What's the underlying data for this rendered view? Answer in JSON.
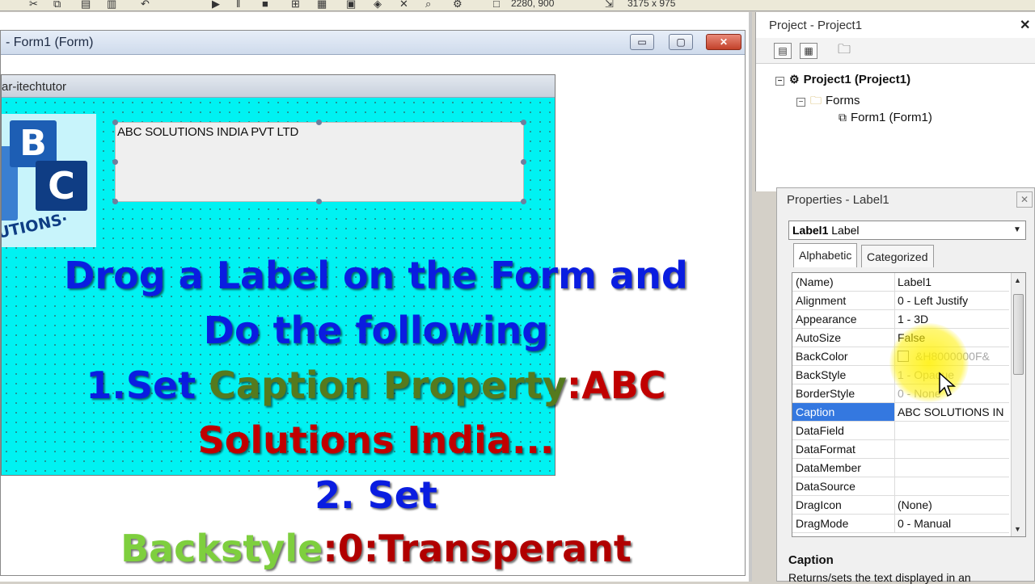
{
  "toolbar": {
    "position_readout": "2280, 900",
    "size_readout": "3175 x 975"
  },
  "designer": {
    "title": "- Form1 (Form)",
    "btn_min": "▭",
    "btn_max": "▢",
    "btn_close": "✕"
  },
  "form": {
    "title": "ar-itechtutor",
    "label_caption": "ABC SOLUTIONS INDIA PVT LTD",
    "logo": {
      "b": "B",
      "c": "C",
      "sub": "UTIONS·"
    }
  },
  "overlay": {
    "line1": "Drog  a Label on the Form and",
    "line2": "Do the following",
    "line3_a": "1.Set ",
    "line3_b": "Caption Property",
    "line3_c": ":ABC",
    "line4": "Solutions India...",
    "line5": "2. Set",
    "line6_a": "Backstyle",
    "line6_b": ":0:Transperant"
  },
  "project": {
    "title": "Project - Project1",
    "close": "✕",
    "tree": [
      {
        "label": "Project1 (Project1)",
        "bold": true
      },
      {
        "label": "Forms"
      },
      {
        "label": "Form1 (Form1)"
      }
    ]
  },
  "properties": {
    "title": "Properties - Label1",
    "close": "✕",
    "object_name": "Label1",
    "object_type": "Label",
    "tabs": [
      "Alphabetic",
      "Categorized"
    ],
    "rows": [
      {
        "name": "(Name)",
        "value": "Label1"
      },
      {
        "name": "Alignment",
        "value": "0 - Left Justify"
      },
      {
        "name": "Appearance",
        "value": "1 - 3D"
      },
      {
        "name": "AutoSize",
        "value": "False"
      },
      {
        "name": "BackColor",
        "value": "&H8000000F&"
      },
      {
        "name": "BackStyle",
        "value": "1 - Opaque"
      },
      {
        "name": "BorderStyle",
        "value": "0 - None"
      },
      {
        "name": "Caption",
        "value": "ABC SOLUTIONS IN"
      },
      {
        "name": "DataField",
        "value": ""
      },
      {
        "name": "DataFormat",
        "value": ""
      },
      {
        "name": "DataMember",
        "value": ""
      },
      {
        "name": "DataSource",
        "value": ""
      },
      {
        "name": "DragIcon",
        "value": "(None)"
      },
      {
        "name": "DragMode",
        "value": "0 - Manual"
      }
    ],
    "selected_row": "Caption",
    "description_title": "Caption",
    "description_text": "Returns/sets the text displayed in an"
  },
  "colors": {
    "form_back": "#00f2f2",
    "selection": "#3478e0",
    "highlight": "#fff000"
  }
}
